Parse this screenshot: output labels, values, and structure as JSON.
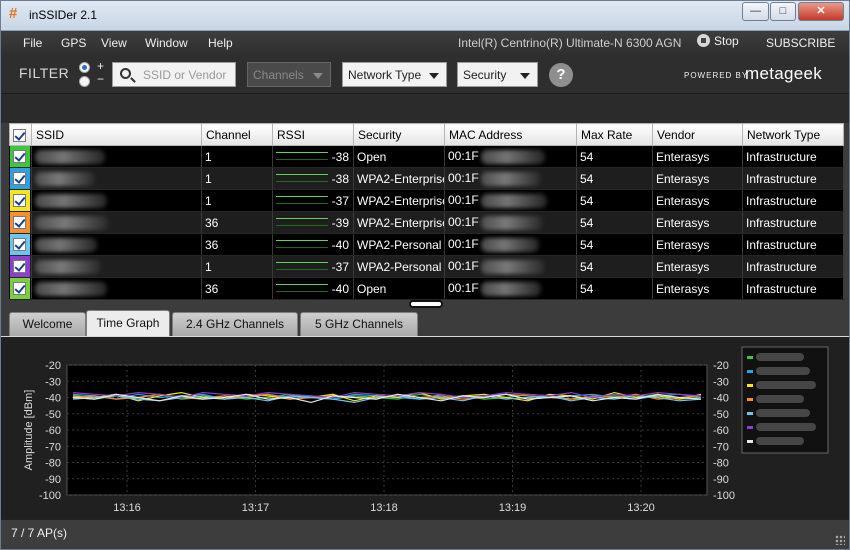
{
  "app": {
    "title": "inSSIDer 2.1"
  },
  "window_controls": {
    "minimize": "—",
    "maximize": "□",
    "close": "✕"
  },
  "menu": [
    "File",
    "GPS",
    "View",
    "Window",
    "Help"
  ],
  "adapter": "Intel(R) Centrino(R) Ultimate-N 6300 AGN",
  "stop_label": "Stop",
  "subscribe_label": "SUBSCRIBE",
  "filter": {
    "label": "FILTER",
    "plus": "+",
    "minus": "−",
    "search_placeholder": "SSID or Vendor",
    "channels": "Channels",
    "network_type": "Network Type",
    "security": "Security",
    "help": "?"
  },
  "branding": {
    "powered_by": "POWERED BY",
    "name": "metageek"
  },
  "table": {
    "columns": [
      "SSID",
      "Channel",
      "RSSI",
      "Security",
      "MAC Address",
      "Max Rate",
      "Vendor",
      "Network Type"
    ],
    "rows": [
      {
        "color": "#3cc83c",
        "channel": "1",
        "rssi": "-38",
        "security": "Open",
        "mac": "00:1F",
        "max_rate": "54",
        "vendor": "Enterasys",
        "network_type": "Infrastructure"
      },
      {
        "color": "#2f9fe3",
        "channel": "1",
        "rssi": "-38",
        "security": "WPA2-Enterprise",
        "mac": "00:1F",
        "max_rate": "54",
        "vendor": "Enterasys",
        "network_type": "Infrastructure"
      },
      {
        "color": "#f4e51c",
        "channel": "1",
        "rssi": "-37",
        "security": "WPA2-Enterprise",
        "mac": "00:1F",
        "max_rate": "54",
        "vendor": "Enterasys",
        "network_type": "Infrastructure"
      },
      {
        "color": "#f29032",
        "channel": "36",
        "rssi": "-39",
        "security": "WPA2-Enterprise",
        "mac": "00:1F",
        "max_rate": "54",
        "vendor": "Enterasys",
        "network_type": "Infrastructure"
      },
      {
        "color": "#6ec6f0",
        "channel": "36",
        "rssi": "-40",
        "security": "WPA2-Personal",
        "mac": "00:1F",
        "max_rate": "54",
        "vendor": "Enterasys",
        "network_type": "Infrastructure"
      },
      {
        "color": "#8e3fd0",
        "channel": "1",
        "rssi": "-37",
        "security": "WPA2-Personal",
        "mac": "00:1F",
        "max_rate": "54",
        "vendor": "Enterasys",
        "network_type": "Infrastructure"
      },
      {
        "color": "#7ccf3c",
        "channel": "36",
        "rssi": "-40",
        "security": "Open",
        "mac": "00:1F",
        "max_rate": "54",
        "vendor": "Enterasys",
        "network_type": "Infrastructure"
      }
    ]
  },
  "tabs": [
    "Welcome",
    "Time Graph",
    "2.4 GHz Channels",
    "5 GHz Channels"
  ],
  "active_tab": "Time Graph",
  "status": "7 / 7 AP(s)",
  "chart_data": {
    "type": "line",
    "ylabel": "Amplitude [dBm]",
    "ylim": [
      -100,
      -20
    ],
    "yticks": [
      -20,
      -30,
      -40,
      -50,
      -60,
      -70,
      -80,
      -90,
      -100
    ],
    "x_ticks": [
      "13:16",
      "13:17",
      "13:18",
      "13:19",
      "13:20"
    ],
    "grid": true,
    "legend_placement": "right",
    "series": [
      {
        "color": "#3cc83c",
        "values": [
          -40,
          -41,
          -39,
          -40,
          -38,
          -41,
          -40,
          -39,
          -41,
          -40,
          -38,
          -40,
          -41,
          -39,
          -40,
          -41,
          -38,
          -40,
          -39,
          -41,
          -40,
          -38,
          -39,
          -41,
          -40,
          -39,
          -40,
          -38,
          -41,
          -40
        ]
      },
      {
        "color": "#2f9fe3",
        "values": [
          -38,
          -39,
          -41,
          -38,
          -40,
          -39,
          -38,
          -41,
          -39,
          -38,
          -40,
          -39,
          -41,
          -38,
          -39,
          -40,
          -41,
          -38,
          -40,
          -39,
          -38,
          -41,
          -40,
          -39,
          -38,
          -40,
          -41,
          -39,
          -38,
          -40
        ]
      },
      {
        "color": "#f4e51c",
        "values": [
          -39,
          -40,
          -38,
          -42,
          -39,
          -37,
          -40,
          -41,
          -38,
          -39,
          -41,
          -40,
          -38,
          -42,
          -39,
          -40,
          -37,
          -41,
          -39,
          -38,
          -40,
          -42,
          -38,
          -39,
          -41,
          -37,
          -40,
          -39,
          -41,
          -38
        ]
      },
      {
        "color": "#f29032",
        "values": [
          -40,
          -39,
          -41,
          -40,
          -38,
          -40,
          -41,
          -39,
          -40,
          -38,
          -41,
          -40,
          -39,
          -40,
          -41,
          -38,
          -40,
          -39,
          -41,
          -40,
          -38,
          -39,
          -40,
          -41,
          -39,
          -40,
          -38,
          -41,
          -40,
          -39
        ]
      },
      {
        "color": "#6ec6f0",
        "values": [
          -41,
          -40,
          -39,
          -41,
          -42,
          -40,
          -39,
          -41,
          -40,
          -42,
          -39,
          -40,
          -41,
          -43,
          -40,
          -39,
          -41,
          -40,
          -42,
          -39,
          -41,
          -40,
          -39,
          -42,
          -40,
          -41,
          -39,
          -40,
          -42,
          -41
        ]
      },
      {
        "color": "#8e3fd0",
        "values": [
          -37,
          -38,
          -39,
          -37,
          -38,
          -40,
          -37,
          -38,
          -39,
          -37,
          -38,
          -39,
          -40,
          -37,
          -38,
          -39,
          -37,
          -38,
          -40,
          -39,
          -37,
          -38,
          -39,
          -37,
          -40,
          -38,
          -39,
          -37,
          -38,
          -39
        ]
      },
      {
        "color": "#e8e8e8",
        "values": [
          -40,
          -41,
          -38,
          -40,
          -42,
          -39,
          -41,
          -40,
          -38,
          -41,
          -40,
          -43,
          -39,
          -40,
          -41,
          -38,
          -40,
          -42,
          -39,
          -40,
          -38,
          -41,
          -40,
          -39,
          -42,
          -40,
          -41,
          -38,
          -40,
          -41
        ]
      }
    ]
  }
}
